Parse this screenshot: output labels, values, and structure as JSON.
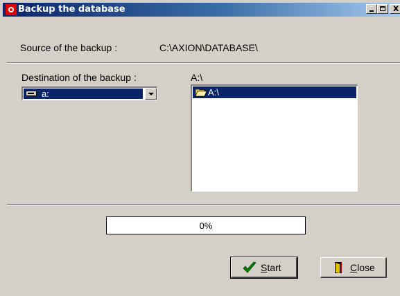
{
  "window": {
    "title": "Backup the database",
    "controls": {
      "minimize": "minimize",
      "maximize": "maximize",
      "close": "x"
    }
  },
  "source": {
    "label": "Source of the backup :",
    "value": "C:\\AXION\\DATABASE\\"
  },
  "destination": {
    "label": "Destination of the backup :",
    "drive": {
      "selected": "a:",
      "icon": "floppy-drive-icon"
    },
    "current_path": "A:\\",
    "folders": [
      {
        "label": "A:\\",
        "icon": "open-folder-icon",
        "selected": true
      }
    ]
  },
  "progress": {
    "value": 0,
    "text": "0%"
  },
  "buttons": {
    "start": {
      "label_first": "S",
      "label_rest": "tart",
      "icon": "checkmark-icon"
    },
    "close": {
      "label_first": "C",
      "label_rest": "lose",
      "icon": "exit-door-icon"
    }
  },
  "colors": {
    "selection": "#0a246a",
    "face": "#d4d0c8",
    "check_green": "#008000"
  }
}
